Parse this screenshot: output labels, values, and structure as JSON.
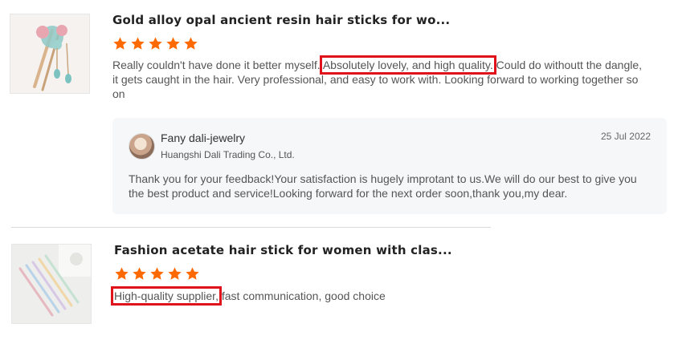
{
  "reviews": [
    {
      "title": "Gold alloy opal ancient resin hair sticks for wo...",
      "rating": 5,
      "text_before": "Really couldn't have done it better myself.",
      "text_highlight": "Absolutely lovely, and high quality.",
      "text_after": "Could do withoutt the dangle, it gets caught in the hair. Very professional, and easy to work with. Looking forward to working together so on",
      "reply": {
        "seller_name": "Fany dali-jewelry",
        "company": "Huangshi Dali Trading Co., Ltd.",
        "date": "25 Jul 2022",
        "text": "Thank you for your feedback!Your satisfaction is hugely improtant to us.We will do our best to give you the best product and service!Looking forward for the next order soon,thank you,my dear."
      }
    },
    {
      "title": "Fashion acetate hair stick for women with clas...",
      "rating": 5,
      "text_highlight": "High-quality supplier,",
      "text_after": "fast communication, good choice"
    }
  ],
  "colors": {
    "star": "#ff6a00",
    "highlight_box": "#e0121b"
  },
  "icons": {
    "rating": "star-icon"
  }
}
